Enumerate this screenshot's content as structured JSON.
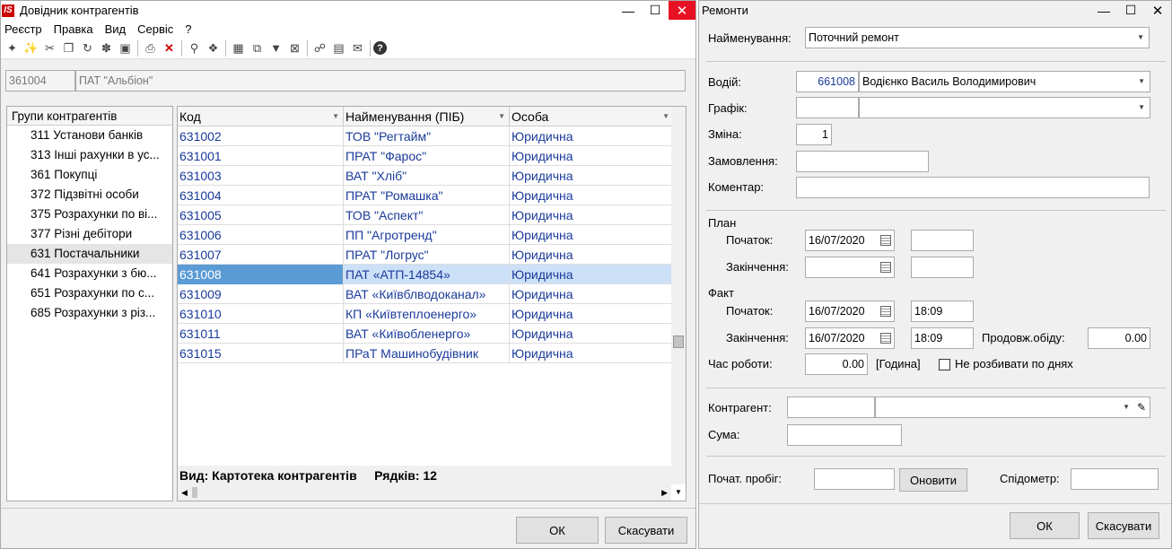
{
  "left_window": {
    "title": "Довідник контрагентів",
    "app_icon": "IS",
    "menu": [
      "Реєстр",
      "Правка",
      "Вид",
      "Сервіс",
      "?"
    ],
    "toolbar_icons": [
      "new-icon",
      "new-copy-icon",
      "delete-mark-icon",
      "copy-icon",
      "refresh-icon",
      "group-icon",
      "archive-icon",
      "print-icon",
      "delete-icon",
      "search-icon",
      "attach-icon",
      "table-icon",
      "export-icon",
      "filter-icon",
      "clear-filter-icon",
      "link-icon",
      "document-icon",
      "mail-icon",
      "help-icon"
    ],
    "header": {
      "code": "361004",
      "name": "ПАТ \"Альбіон\""
    },
    "tree": {
      "header": "Групи контрагентів",
      "items": [
        {
          "label": "311 Установи банків"
        },
        {
          "label": "313 Інші рахунки в ус..."
        },
        {
          "label": "361 Покупці"
        },
        {
          "label": "372 Підзвітні особи"
        },
        {
          "label": "375 Розрахунки по ві..."
        },
        {
          "label": "377 Різні дебітори"
        },
        {
          "label": "631 Постачальники"
        },
        {
          "label": "641 Розрахунки з бю..."
        },
        {
          "label": "651 Розрахунки по с..."
        },
        {
          "label": "685 Розрахунки з різ..."
        }
      ],
      "selected_index": 6
    },
    "grid": {
      "columns": [
        "Код",
        "Найменування (ПІБ)",
        "Особа"
      ],
      "rows": [
        [
          "631002",
          "ТОВ \"Регтайм\"",
          "Юридична"
        ],
        [
          "631001",
          "ПРАТ \"Фарос\"",
          "Юридична"
        ],
        [
          "631003",
          "ВАТ \"Хліб\"",
          "Юридична"
        ],
        [
          "631004",
          "ПРАТ \"Ромашка\"",
          "Юридична"
        ],
        [
          "631005",
          "ТОВ \"Аспект\"",
          "Юридична"
        ],
        [
          "631006",
          "ПП \"Агротренд\"",
          "Юридична"
        ],
        [
          "631007",
          "ПРАТ \"Логрус\"",
          "Юридична"
        ],
        [
          "631008",
          "ПАТ «АТП-14854»",
          "Юридична"
        ],
        [
          "631009",
          "ВАТ «Київблводоканал»",
          "Юридична"
        ],
        [
          "631010",
          "КП «Київтеплоенерго»",
          "Юридична"
        ],
        [
          "631011",
          "ВАТ «Київобленерго»",
          "Юридична"
        ],
        [
          "631015",
          "ПРаТ Машинобудівник",
          "Юридична"
        ]
      ],
      "selected_row": 7,
      "status": "Вид: Картотека контрагентів     Рядків: 12"
    },
    "ok_label": "ОК",
    "cancel_label": "Скасувати"
  },
  "right_window": {
    "title": "Ремонти",
    "name_label": "Найменування:",
    "name_value": "Поточний ремонт",
    "driver_label": "Водій:",
    "driver_code": "661008",
    "driver_name": "Водієнко Василь Володимирович",
    "schedule_label": "Графік:",
    "shift_label": "Зміна:",
    "shift_value": "1",
    "order_label": "Замовлення:",
    "comment_label": "Коментар:",
    "plan_label": "План",
    "plan_start_label": "Початок:",
    "plan_start_date": "16/07/2020",
    "plan_end_label": "Закінчення:",
    "fact_label": "Факт",
    "fact_start_label": "Початок:",
    "fact_start_date": "16/07/2020",
    "fact_start_time": "18:09",
    "fact_end_label": "Закінчення:",
    "fact_end_date": "16/07/2020",
    "fact_end_time": "18:09",
    "lunch_label": "Продовж.обіду:",
    "lunch_value": "0.00",
    "work_time_label": "Час роботи:",
    "work_time_value": "0.00",
    "work_time_unit": "[Година]",
    "no_split_label": "Не розбивати по днях",
    "counterparty_label": "Контрагент:",
    "sum_label": "Сума:",
    "mileage_label": "Почат. пробіг:",
    "update_label": "Оновити",
    "speedometer_label": "Спідометр:",
    "ok_label": "ОК",
    "cancel_label": "Скасувати"
  }
}
